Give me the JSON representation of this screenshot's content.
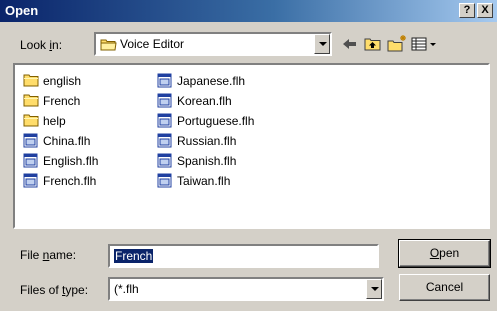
{
  "window": {
    "title": "Open",
    "help_label": "?",
    "close_label": "X"
  },
  "look_in": {
    "label_pre": "Look ",
    "label_key": "i",
    "label_post": "n:",
    "value": "Voice Editor",
    "icon": "folder-icon"
  },
  "toolbar": {
    "icons": [
      "back-arrow-icon",
      "up-one-level-icon",
      "new-folder-icon",
      "view-menu-icon"
    ]
  },
  "files": {
    "column1": [
      {
        "name": "english",
        "type": "folder"
      },
      {
        "name": "French",
        "type": "folder"
      },
      {
        "name": "help",
        "type": "folder"
      },
      {
        "name": "China.flh",
        "type": "file"
      },
      {
        "name": "English.flh",
        "type": "file"
      },
      {
        "name": "French.flh",
        "type": "file"
      }
    ],
    "column2": [
      {
        "name": "Japanese.flh",
        "type": "file"
      },
      {
        "name": "Korean.flh",
        "type": "file"
      },
      {
        "name": "Portuguese.flh",
        "type": "file"
      },
      {
        "name": "Russian.flh",
        "type": "file"
      },
      {
        "name": "Spanish.flh",
        "type": "file"
      },
      {
        "name": "Taiwan.flh",
        "type": "file"
      }
    ]
  },
  "file_name": {
    "label_pre": "File ",
    "label_key": "n",
    "label_post": "ame:",
    "value": "French"
  },
  "file_type": {
    "label_pre": "Files of ",
    "label_key": "t",
    "label_post": "ype:",
    "value": "(*.flh"
  },
  "buttons": {
    "open_key": "O",
    "open_rest": "pen",
    "cancel": "Cancel"
  }
}
